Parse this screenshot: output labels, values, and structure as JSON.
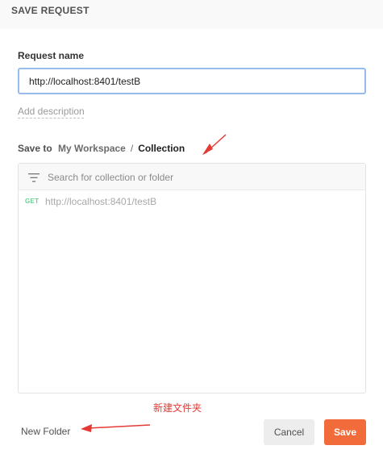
{
  "dialog": {
    "title": "SAVE REQUEST"
  },
  "request_name": {
    "label": "Request name",
    "value": "http://localhost:8401/testB"
  },
  "add_description": "Add description",
  "save_to": {
    "label": "Save to",
    "breadcrumb": [
      "My Workspace",
      "Collection"
    ],
    "separator": "/"
  },
  "tree": {
    "search_placeholder": "Search for collection or folder",
    "items": [
      {
        "method": "GET",
        "name": "http://localhost:8401/testB"
      }
    ]
  },
  "annotation_text": "新建文件夹",
  "footer": {
    "new_folder": "New Folder",
    "cancel": "Cancel",
    "save": "Save"
  },
  "colors": {
    "accent": "#f26b3a",
    "input_focus_border": "#97bbed",
    "get_method": "#6bcf95",
    "annotation": "#e53935"
  }
}
